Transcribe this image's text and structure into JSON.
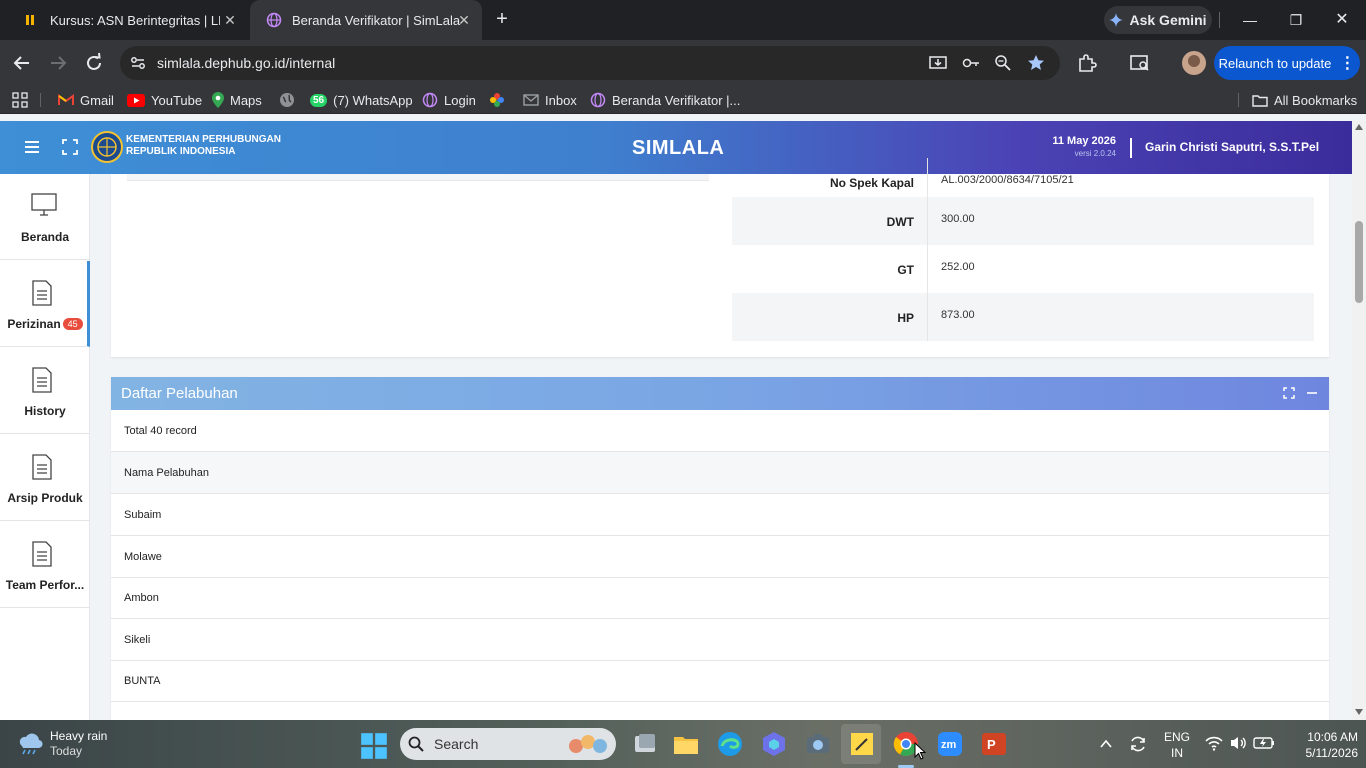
{
  "browser": {
    "tabs": [
      {
        "title": "Kursus: ASN Berintegritas | LMS"
      },
      {
        "title": "Beranda Verifikator | SimLala"
      }
    ],
    "ask_gemini": "Ask Gemini",
    "url": "simlala.dephub.go.id/internal",
    "relaunch_label": "Relaunch to update",
    "bookmarks": [
      "Gmail",
      "YouTube",
      "Maps",
      "(7) WhatsApp",
      "Login",
      "Inbox",
      "Beranda Verifikator |..."
    ],
    "whatsapp_count": "56",
    "all_bookmarks": "All Bookmarks"
  },
  "header": {
    "logo_line1": "KEMENTERIAN PERHUBUNGAN",
    "logo_line2": "REPUBLIK INDONESIA",
    "app_title": "SIMLALA",
    "date": "11 May 2026",
    "version": "versi 2.0.24",
    "user": "Garin Christi Saputri, S.S.T.Pel"
  },
  "sidebar": {
    "items": [
      {
        "label": "Beranda"
      },
      {
        "label": "Perizinan",
        "badge": "45"
      },
      {
        "label": "History"
      },
      {
        "label": "Arsip Produk"
      },
      {
        "label": "Team Perfor..."
      }
    ]
  },
  "spec": {
    "rows": [
      {
        "label": "No Spek Kapal",
        "value": "AL.003/2000/8634/7105/21"
      },
      {
        "label": "DWT",
        "value": "300.00"
      },
      {
        "label": "GT",
        "value": "252.00"
      },
      {
        "label": "HP",
        "value": "873.00"
      }
    ]
  },
  "ports": {
    "title": "Daftar Pelabuhan",
    "total": "Total 40 record",
    "column": "Nama Pelabuhan",
    "rows": [
      "Subaim",
      "Molawe",
      "Ambon",
      "Sikeli",
      "BUNTA"
    ]
  },
  "taskbar": {
    "weather_title": "Heavy rain",
    "weather_sub": "Today",
    "search_placeholder": "Search",
    "lang1": "ENG",
    "lang2": "IN",
    "time": "10:06 AM",
    "date": "5/11/2026"
  }
}
